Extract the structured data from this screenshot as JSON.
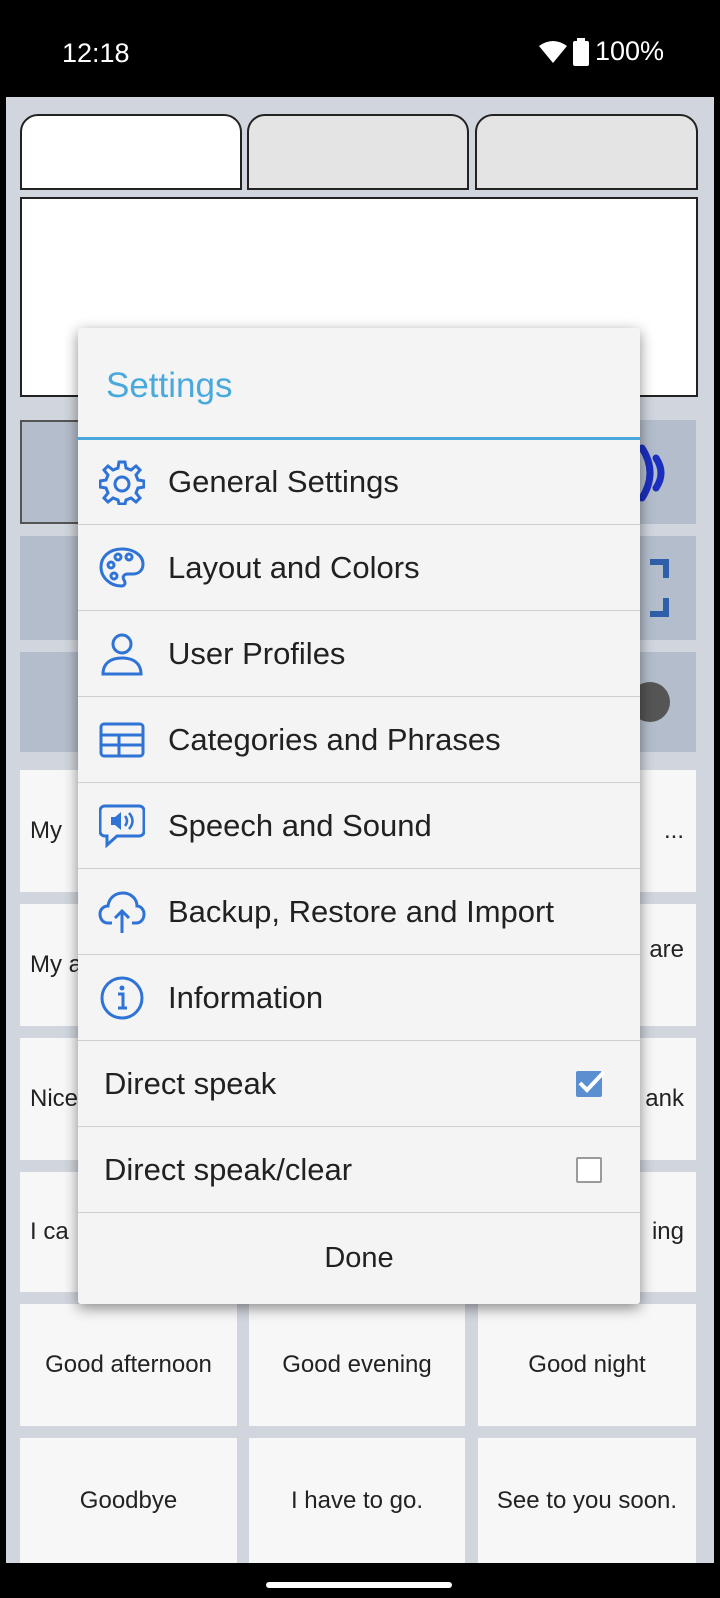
{
  "status": {
    "time": "12:18",
    "battery": "100%"
  },
  "dialog": {
    "title": "Settings",
    "items": [
      {
        "label": "General Settings",
        "icon": "gear-icon"
      },
      {
        "label": "Layout and Colors",
        "icon": "palette-icon"
      },
      {
        "label": "User Profiles",
        "icon": "user-icon"
      },
      {
        "label": "Categories and Phrases",
        "icon": "table-icon"
      },
      {
        "label": "Speech and Sound",
        "icon": "speech-bubble-icon"
      },
      {
        "label": "Backup, Restore and Import",
        "icon": "cloud-upload-icon"
      },
      {
        "label": "Information",
        "icon": "info-icon"
      }
    ],
    "checks": [
      {
        "label": "Direct speak",
        "checked": true
      },
      {
        "label": "Direct speak/clear",
        "checked": false
      }
    ],
    "done": "Done"
  },
  "phrases": {
    "r1c1": "My",
    "r1c3": "...",
    "r2c1": "My a",
    "r2c3": "are",
    "r3c1": "Nice",
    "r3c3": "ank",
    "r4c1": "I ca",
    "r4c3": "ing",
    "r5": [
      "Good afternoon",
      "Good evening",
      "Good night"
    ],
    "r6": [
      "Goodbye",
      "I have to go.",
      "See to you soon."
    ]
  },
  "colors": {
    "accent": "#4aa9dc",
    "icon": "#2f73d6",
    "control_bg": "#b4bdcb"
  }
}
